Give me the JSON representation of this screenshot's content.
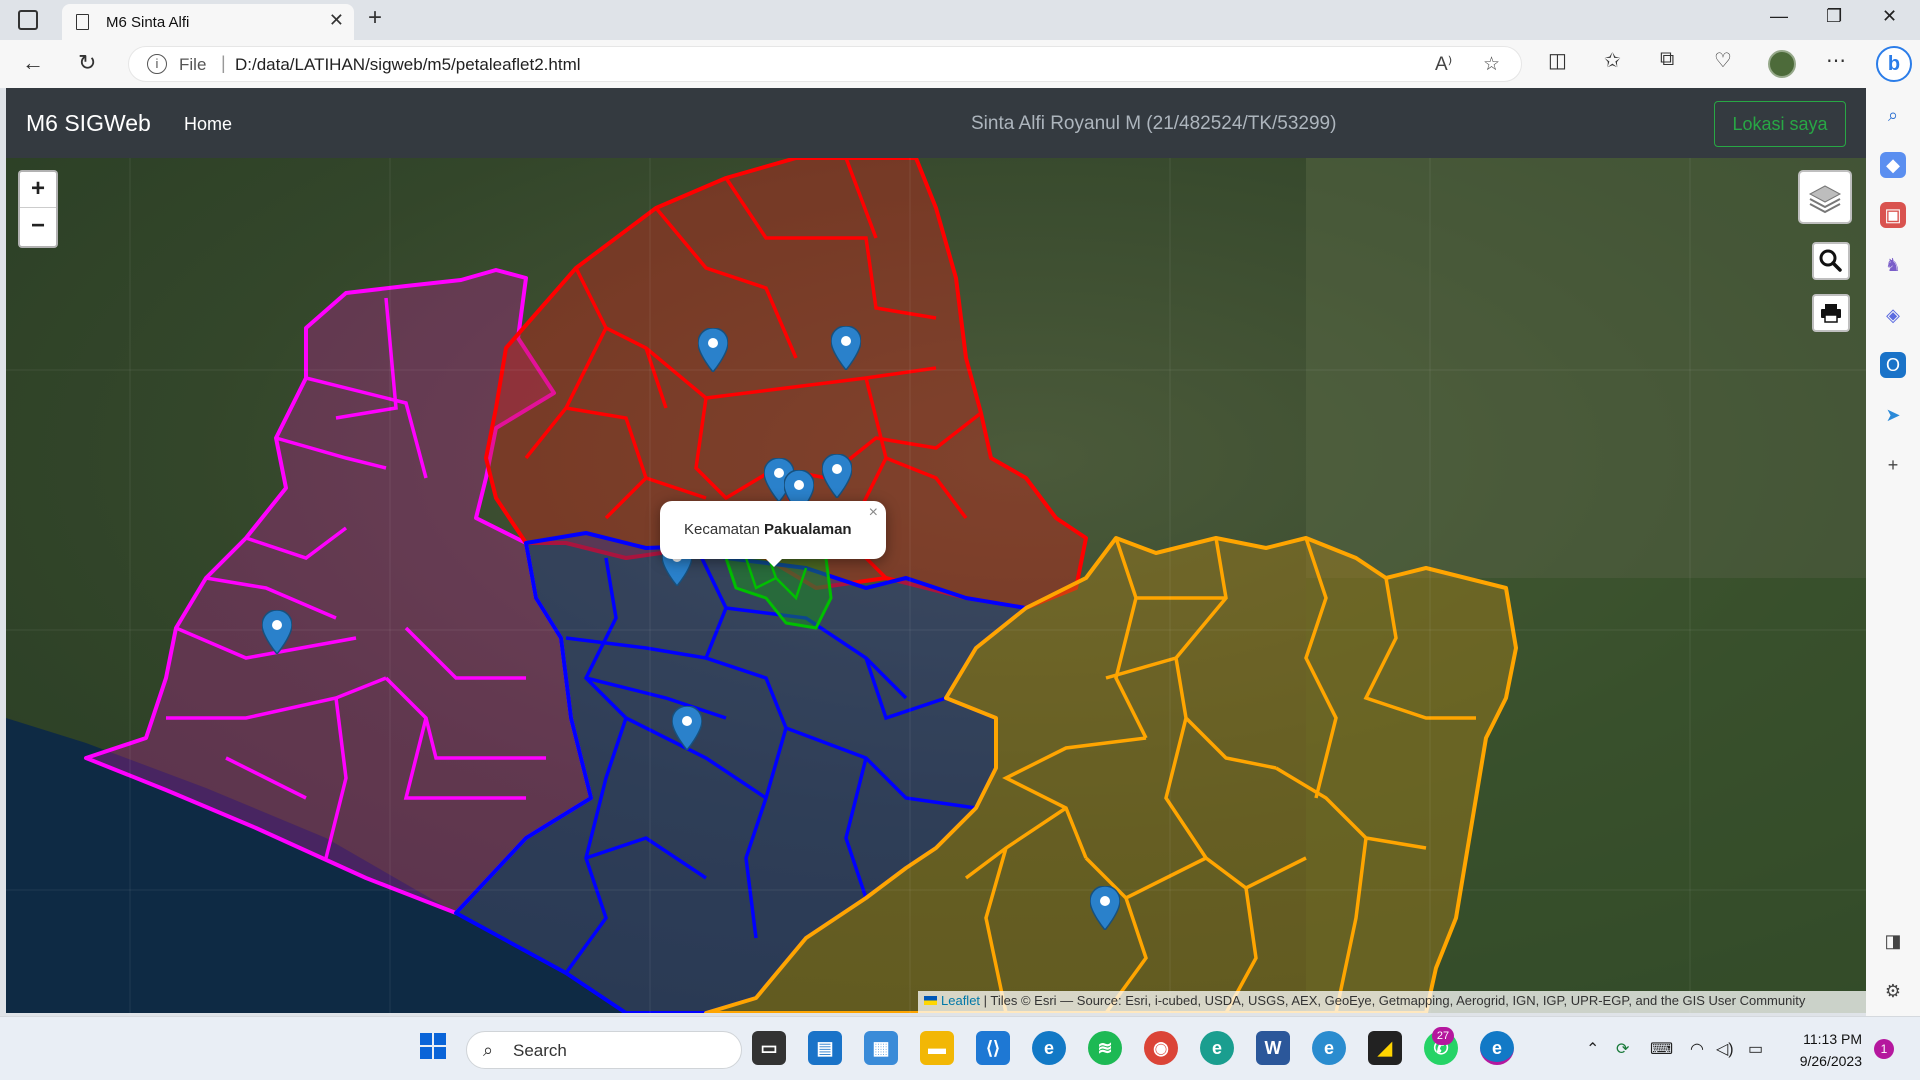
{
  "browser": {
    "tab_title": "M6 Sinta Alfi",
    "address_scheme": "File",
    "address_url": "D:/data/LATIHAN/sigweb/m5/petaleaflet2.html"
  },
  "navbar": {
    "brand": "M6 SIGWeb",
    "home_label": "Home",
    "author": "Sinta Alfi Royanul M (21/482524/TK/53299)",
    "locate_button": "Lokasi saya"
  },
  "map": {
    "zoom_in": "+",
    "zoom_out": "−",
    "popup_prefix": "Kecamatan ",
    "popup_name": "Pakualaman",
    "popup_close": "×",
    "attribution_leaflet": "Leaflet",
    "attribution_rest": " | Tiles © Esri — Source: Esri, i-cubed, USDA, USGS, AEX, GeoEye, Getmapping, Aerogrid, IGN, IGP, UPR-EGP, and the GIS User Community",
    "region_colors": {
      "sleman": "#ff0000",
      "kulon_progo": "#ff00ff",
      "bantul": "#0000ff",
      "gunung_kidul": "#ffa500",
      "kota_yogyakarta": "#00c000"
    }
  },
  "taskbar": {
    "search_label": "Search",
    "whatsapp_badge": "27",
    "time": "11:13 PM",
    "date": "9/26/2023",
    "notification_count": "1"
  }
}
